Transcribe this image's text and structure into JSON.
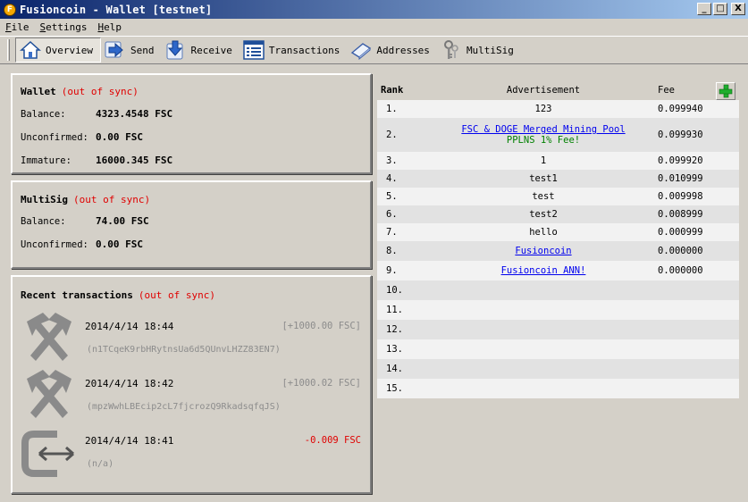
{
  "window": {
    "title": "Fusioncoin - Wallet [testnet]",
    "app_icon_letter": "F",
    "min_label": "_",
    "max_label": "□",
    "close_label": "X"
  },
  "menu": [
    {
      "key": "F",
      "rest": "ile"
    },
    {
      "key": "S",
      "rest": "ettings"
    },
    {
      "key": "H",
      "rest": "elp"
    }
  ],
  "toolbar": {
    "overview": "Overview",
    "send": "Send",
    "receive": "Receive",
    "transactions": "Transactions",
    "addresses": "Addresses",
    "multisig": "MultiSig"
  },
  "wallet": {
    "title": "Wallet",
    "sync": "(out of sync)",
    "balance_label": "Balance:",
    "balance": "4323.4548 FSC",
    "unconfirmed_label": "Unconfirmed:",
    "unconfirmed": "0.00 FSC",
    "immature_label": "Immature:",
    "immature": "16000.345 FSC"
  },
  "multisig": {
    "title": "MultiSig",
    "sync": "(out of sync)",
    "balance_label": "Balance:",
    "balance": "74.00 FSC",
    "unconfirmed_label": "Unconfirmed:",
    "unconfirmed": "0.00 FSC"
  },
  "recent": {
    "title": "Recent transactions",
    "sync": "(out of sync)",
    "items": [
      {
        "icon": "mining-icon",
        "date": "2014/4/14 18:44",
        "amount": "[+1000.00 FSC]",
        "address": "(n1TCqeK9rbHRytnsUa6d5QUnvLHZZ83EN7)"
      },
      {
        "icon": "mining-icon",
        "date": "2014/4/14 18:42",
        "amount": "[+1000.02 FSC]",
        "address": "(mpzWwhLBEcip2cL7fjcrozQ9RkadsqfqJS)"
      },
      {
        "icon": "payment-to-self-icon",
        "date": "2014/4/14 18:41",
        "amount": "-0.009 FSC",
        "address": "(n/a)"
      }
    ]
  },
  "ads": {
    "headers": {
      "rank": "Rank",
      "ad": "Advertisement",
      "fee": "Fee"
    },
    "rows": [
      {
        "rank": "1.",
        "ad": "123",
        "sub": "",
        "link": false,
        "fee": "0.099940"
      },
      {
        "rank": "2.",
        "ad": "FSC & DOGE Merged Mining Pool",
        "sub": "PPLNS 1% Fee!",
        "link": true,
        "fee": "0.099930"
      },
      {
        "rank": "3.",
        "ad": "1",
        "sub": "",
        "link": false,
        "fee": "0.099920"
      },
      {
        "rank": "4.",
        "ad": "test1",
        "sub": "",
        "link": false,
        "fee": "0.010999"
      },
      {
        "rank": "5.",
        "ad": "test",
        "sub": "",
        "link": false,
        "fee": "0.009998"
      },
      {
        "rank": "6.",
        "ad": "test2",
        "sub": "",
        "link": false,
        "fee": "0.008999"
      },
      {
        "rank": "7.",
        "ad": "hello",
        "sub": "",
        "link": false,
        "fee": "0.000999"
      },
      {
        "rank": "8.",
        "ad": "Fusioncoin",
        "sub": "",
        "link": true,
        "fee": "0.000000"
      },
      {
        "rank": "9.",
        "ad": "Fusioncoin ANN!",
        "sub": "",
        "link": true,
        "fee": "0.000000"
      },
      {
        "rank": "10.",
        "ad": "",
        "sub": "",
        "link": false,
        "fee": ""
      },
      {
        "rank": "11.",
        "ad": "",
        "sub": "",
        "link": false,
        "fee": ""
      },
      {
        "rank": "12.",
        "ad": "",
        "sub": "",
        "link": false,
        "fee": ""
      },
      {
        "rank": "13.",
        "ad": "",
        "sub": "",
        "link": false,
        "fee": ""
      },
      {
        "rank": "14.",
        "ad": "",
        "sub": "",
        "link": false,
        "fee": ""
      },
      {
        "rank": "15.",
        "ad": "",
        "sub": "",
        "link": false,
        "fee": ""
      }
    ]
  },
  "colors": {
    "accent_red": "#e00000",
    "link_blue": "#0000ee",
    "green": "#008000"
  }
}
